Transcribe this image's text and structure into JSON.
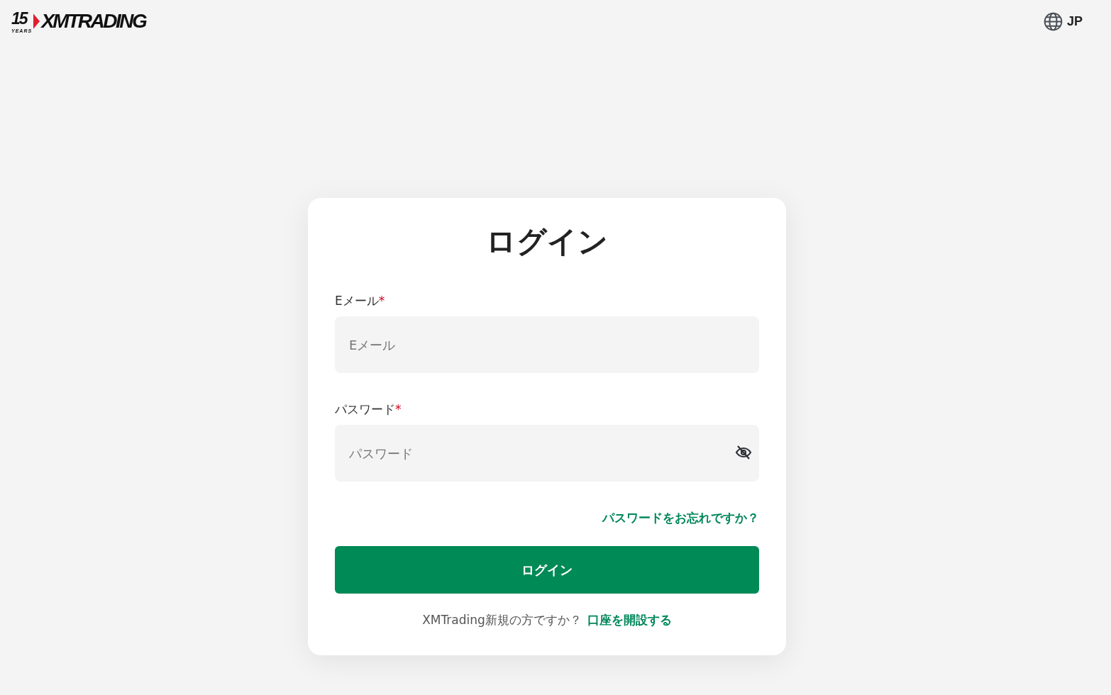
{
  "header": {
    "logo": {
      "years_number": "15",
      "years_label": "YEARS",
      "brand": "XMTRADING"
    },
    "language": "JP"
  },
  "login_card": {
    "title": "ログイン",
    "fields": [
      {
        "label": "Eメール",
        "required_mark": "*",
        "placeholder": "Eメール",
        "kind": "text"
      },
      {
        "label": "パスワード",
        "required_mark": "*",
        "placeholder": "パスワード",
        "kind": "password"
      }
    ],
    "forgot_link": "パスワードをお忘れですか？",
    "submit": "ログイン",
    "signup": {
      "text": "XMTrading新規の方ですか？",
      "link": "口座を開設する"
    }
  }
}
